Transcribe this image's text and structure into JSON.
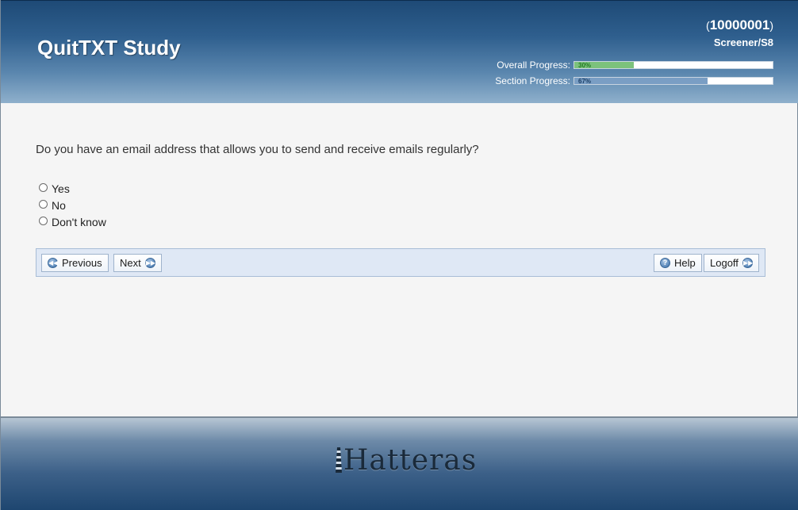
{
  "header": {
    "title": "QuitTXT Study",
    "respondent_id": "10000001",
    "section_code": "Screener/S8",
    "overall_progress": {
      "label": "Overall Progress:",
      "percent_text": "30%",
      "fraction": 0.3
    },
    "section_progress": {
      "label": "Section Progress:",
      "percent_text": "67%",
      "fraction": 0.67
    }
  },
  "main": {
    "question": "Do you have an email address that allows you to send and receive emails regularly?",
    "options": [
      "Yes",
      "No",
      "Don't know"
    ]
  },
  "navbar": {
    "previous_label": "Previous",
    "next_label": "Next",
    "help_label": "Help",
    "logoff_label": "Logoff"
  },
  "footer": {
    "brand": "Hatteras"
  },
  "colors": {
    "header_dark": "#1e4a76",
    "overall_fill": "#7cc27c",
    "section_fill": "#7a9ec4",
    "navbar_bg": "#dfe8f5"
  }
}
